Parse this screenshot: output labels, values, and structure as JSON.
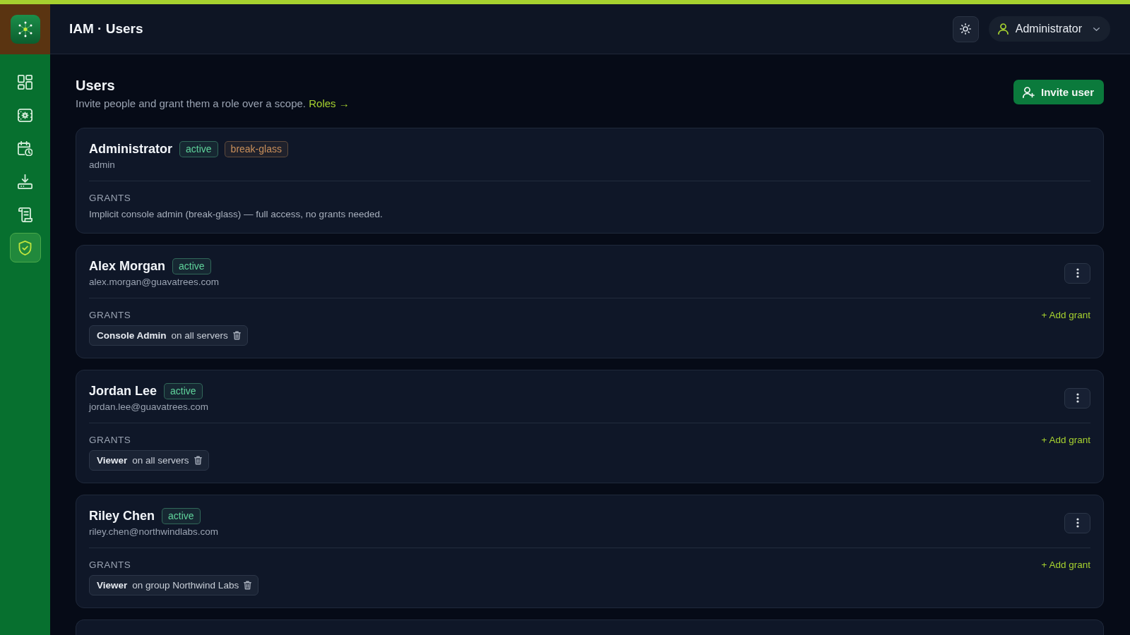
{
  "sidebar": {
    "items": [
      {
        "selected": false
      },
      {
        "selected": false
      },
      {
        "selected": false
      },
      {
        "selected": false
      },
      {
        "selected": false
      },
      {
        "selected": true
      }
    ]
  },
  "header": {
    "title": "IAM · Users",
    "user_menu": {
      "label": "Administrator"
    }
  },
  "page": {
    "title": "Users",
    "subtitle": "Invite people and grant them a role over a scope.",
    "link": "Roles →",
    "invite_button": "Invite user"
  },
  "users": [
    {
      "kind": "break_glass",
      "name": "Administrator",
      "badges": [
        {
          "label": "active",
          "color": "#5fd39b"
        },
        {
          "label": "break-glass",
          "color": "#c98f5a"
        }
      ],
      "login": "admin",
      "grants_label": "GRANTS",
      "note": "Implicit console admin (break-glass) — full access, no grants needed."
    },
    {
      "kind": "user",
      "name": "Alex Morgan",
      "badges": [
        {
          "label": "active",
          "color": "#5fd39b"
        }
      ],
      "login": "alex.morgan@guavatrees.com",
      "grants_label": "GRANTS",
      "add_grant": "+ Add grant",
      "grants": [
        {
          "role": "Console Admin",
          "scope": "on all servers"
        }
      ]
    },
    {
      "kind": "user",
      "name": "Jordan Lee",
      "badges": [
        {
          "label": "active",
          "color": "#5fd39b"
        }
      ],
      "login": "jordan.lee@guavatrees.com",
      "grants_label": "GRANTS",
      "add_grant": "+ Add grant",
      "grants": [
        {
          "role": "Viewer",
          "scope": "on all servers"
        }
      ]
    },
    {
      "kind": "user",
      "name": "Riley Chen",
      "badges": [
        {
          "label": "active",
          "color": "#5fd39b"
        }
      ],
      "login": "riley.chen@northwindlabs.com",
      "grants_label": "GRANTS",
      "add_grant": "+ Add grant",
      "grants": [
        {
          "role": "Viewer",
          "scope": "on group Northwind Labs"
        }
      ]
    }
  ],
  "more_below": true
}
